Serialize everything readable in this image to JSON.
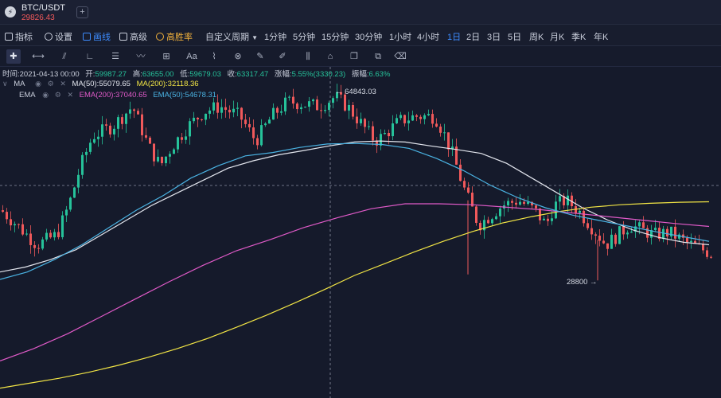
{
  "header": {
    "symbol": "BTC/USDT",
    "last_price": "29826.43",
    "add_tab": "+"
  },
  "toolbar": {
    "indicators": "指标",
    "settings": "设置",
    "drawing": "画线",
    "advanced": "高级",
    "win_rate": "高胜率",
    "custom_period": "自定义周期",
    "timeframes": [
      "1分钟",
      "5分钟",
      "15分钟",
      "30分钟",
      "1小时",
      "4小时",
      "1日",
      "2日",
      "3日",
      "5日",
      "周K",
      "月K",
      "季K",
      "年K"
    ],
    "active_timeframe": "1日"
  },
  "drawing_tools": [
    "crosshair",
    "horizontal-ray",
    "parallel-channel",
    "angle-line",
    "fib-levels",
    "wave-pattern",
    "measure-box",
    "text-tool",
    "ruler",
    "magnet",
    "brush-tool",
    "pencil-tool",
    "candle-pattern",
    "lock-tool",
    "copy-tool",
    "layers-tool",
    "trash-tool"
  ],
  "text_tool_label": "Aa",
  "ohlc": {
    "time_label": "时间:",
    "time": "2021-04-13 00:00",
    "open_label": "开:",
    "open": "59987.27",
    "high_label": "高:",
    "high": "63655.00",
    "low_label": "低:",
    "low": "59679.03",
    "close_label": "收:",
    "close": "63317.47",
    "change_label": "涨幅:",
    "change": "5.55%(3330.23)",
    "amplitude_label": "振幅:",
    "amplitude": "6.63%"
  },
  "indicators": {
    "ma": {
      "name": "MA",
      "ma50_label": "MA(50):55079.65",
      "ma200_label": "MA(200):32118.36"
    },
    "ema": {
      "name": "EMA",
      "ema200_label": "EMA(200):37040.65",
      "ema50_label": "EMA(50):54678.31"
    }
  },
  "annotations": {
    "high_marker": "64843.03",
    "low_marker": "28800"
  },
  "colors": {
    "background": "#151a2b",
    "up": "#26c29a",
    "down": "#f0595b",
    "accent": "#3d8bfd",
    "ma50": "#e3e6ee",
    "ma200": "#f2e545",
    "ema200": "#e05ac8",
    "ema50": "#4ab3e3"
  },
  "chart_data": {
    "type": "candlestick",
    "price_range": [
      5000,
      72000
    ],
    "crosshair_price": 48000,
    "series": [
      {
        "name": "MA(50)",
        "y": [
          30500,
          31500,
          33000,
          35000,
          38000,
          41000,
          44000,
          46500,
          49000,
          51500,
          53000,
          54200,
          55079,
          56000,
          56800,
          57000,
          56800,
          56000,
          55300,
          54500,
          52500,
          49500,
          46500,
          43500,
          41000,
          39000,
          37500,
          36500,
          36000
        ]
      },
      {
        "name": "MA(200)",
        "y": [
          7000,
          8000,
          9000,
          10200,
          11600,
          13200,
          15000,
          17000,
          19300,
          21700,
          24300,
          27000,
          29800,
          32118,
          34500,
          36700,
          38700,
          40400,
          41700,
          42800,
          43600,
          44100,
          44400,
          44600,
          44700
        ]
      },
      {
        "name": "EMA(200)",
        "y": [
          12500,
          15000,
          18000,
          21500,
          25000,
          28500,
          31800,
          34800,
          37040,
          39500,
          41500,
          43300,
          44300,
          44300,
          44100,
          43600,
          43100,
          42400,
          41700,
          41000,
          40300,
          39700
        ]
      },
      {
        "name": "EMA(50)",
        "y": [
          29000,
          30500,
          33000,
          36000,
          39500,
          43000,
          46000,
          49500,
          52000,
          54000,
          54678,
          55700,
          56400,
          56500,
          56300,
          55500,
          53500,
          51000,
          48000,
          45500,
          43500,
          42000,
          40900,
          39800,
          38700,
          37700,
          36700
        ]
      }
    ]
  }
}
